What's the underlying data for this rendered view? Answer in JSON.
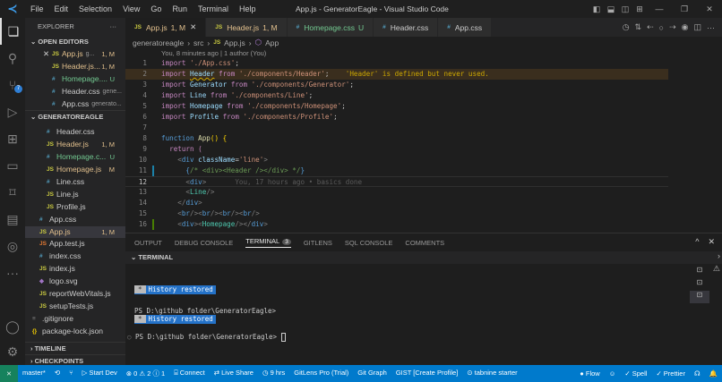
{
  "window": {
    "title": "App.js - GeneratorEagle - Visual Studio Code",
    "menu": [
      "File",
      "Edit",
      "Selection",
      "View",
      "Go",
      "Run",
      "Terminal",
      "Help"
    ]
  },
  "activity": {
    "scm_badge": "7"
  },
  "sidebar": {
    "title": "EXPLORER",
    "more": "···",
    "open_editors_label": "OPEN EDITORS",
    "open_editors": [
      {
        "icon": "JS",
        "name": "App.js",
        "desc": "g...",
        "status": "1, M",
        "cls": "mod",
        "ic": "js",
        "close": "✕"
      },
      {
        "icon": "JS",
        "name": "Header.js...",
        "desc": "",
        "status": "1, M",
        "cls": "mod",
        "ic": "js"
      },
      {
        "icon": "#",
        "name": "Homepage....",
        "desc": "",
        "status": "U",
        "cls": "unt",
        "ic": "css"
      },
      {
        "icon": "#",
        "name": "Header.css",
        "desc": "gene...",
        "status": "",
        "cls": "",
        "ic": "css"
      },
      {
        "icon": "#",
        "name": "App.css",
        "desc": "generato...",
        "status": "",
        "cls": "",
        "ic": "css"
      }
    ],
    "project_label": "GENERATOREAGLE",
    "tree": [
      {
        "icon": "#",
        "name": "Header.css",
        "status": "",
        "cls": "",
        "ic": "css",
        "indent": 2
      },
      {
        "icon": "JS",
        "name": "Header.js",
        "status": "1, M",
        "cls": "mod",
        "ic": "js",
        "indent": 2
      },
      {
        "icon": "#",
        "name": "Homepage.c...",
        "status": "U",
        "cls": "unt",
        "ic": "css",
        "indent": 2
      },
      {
        "icon": "JS",
        "name": "Homepage.js",
        "status": "M",
        "cls": "mod",
        "ic": "js",
        "indent": 2
      },
      {
        "icon": "#",
        "name": "Line.css",
        "status": "",
        "cls": "",
        "ic": "css",
        "indent": 2
      },
      {
        "icon": "JS",
        "name": "Line.js",
        "status": "",
        "cls": "",
        "ic": "js",
        "indent": 2
      },
      {
        "icon": "JS",
        "name": "Profile.js",
        "status": "",
        "cls": "",
        "ic": "js",
        "indent": 2
      },
      {
        "icon": "#",
        "name": "App.css",
        "status": "",
        "cls": "",
        "ic": "css",
        "indent": 1
      },
      {
        "icon": "JS",
        "name": "App.js",
        "status": "1, M",
        "cls": "mod",
        "ic": "js",
        "indent": 1,
        "selected": true
      },
      {
        "icon": "JS",
        "name": "App.test.js",
        "status": "",
        "cls": "",
        "ic": "testjs",
        "indent": 1
      },
      {
        "icon": "#",
        "name": "index.css",
        "status": "",
        "cls": "",
        "ic": "css",
        "indent": 1
      },
      {
        "icon": "JS",
        "name": "index.js",
        "status": "",
        "cls": "",
        "ic": "js",
        "indent": 1
      },
      {
        "icon": "◆",
        "name": "logo.svg",
        "status": "",
        "cls": "",
        "ic": "svg",
        "indent": 1
      },
      {
        "icon": "JS",
        "name": "reportWebVitals.js",
        "status": "",
        "cls": "",
        "ic": "js",
        "indent": 1
      },
      {
        "icon": "JS",
        "name": "setupTests.js",
        "status": "",
        "cls": "",
        "ic": "js",
        "indent": 1
      },
      {
        "icon": "≡",
        "name": ".gitignore",
        "status": "",
        "cls": "",
        "ic": "dim2",
        "indent": 0
      },
      {
        "icon": "{}",
        "name": "package-lock.json",
        "status": "",
        "cls": "",
        "ic": "y",
        "indent": 0
      }
    ],
    "timeline_label": "TIMELINE",
    "checkpoints_label": "CHECKPOINTS"
  },
  "tabs": [
    {
      "icon": "JS",
      "label": "App.js",
      "status": "1, M",
      "cls": "mod",
      "ic": "js",
      "active": true,
      "close": "✕"
    },
    {
      "icon": "JS",
      "label": "Header.js",
      "status": "1, M",
      "cls": "mod",
      "ic": "js"
    },
    {
      "icon": "#",
      "label": "Homepage.css",
      "status": "U",
      "cls": "unt",
      "ic": "css"
    },
    {
      "icon": "#",
      "label": "Header.css",
      "status": "",
      "cls": "",
      "ic": "css"
    },
    {
      "icon": "#",
      "label": "App.css",
      "status": "",
      "cls": "",
      "ic": "css"
    }
  ],
  "breadcrumb": [
    "generatoreagle",
    "src",
    "App.js",
    "App"
  ],
  "editor": {
    "codelens": "You, 8 minutes ago | 1 author (You)",
    "lines": [
      {
        "n": "1",
        "tokens": [
          [
            "import ",
            "k"
          ],
          [
            "'./App.css'",
            "s"
          ],
          [
            ";",
            "p"
          ]
        ]
      },
      {
        "n": "2",
        "hl": true,
        "tokens": [
          [
            "import ",
            "k"
          ],
          [
            "Header",
            "b"
          ],
          [
            " from ",
            "k"
          ],
          [
            "'./components/Header'",
            "s"
          ],
          [
            ";",
            "p"
          ],
          [
            "    'Header' is defined but never used.",
            "err"
          ]
        ]
      },
      {
        "n": "3",
        "tokens": [
          [
            "import ",
            "k"
          ],
          [
            "Generator",
            "b"
          ],
          [
            " from ",
            "k"
          ],
          [
            "'./components/Generator'",
            "s"
          ],
          [
            ";",
            "p"
          ]
        ]
      },
      {
        "n": "4",
        "tokens": [
          [
            "import ",
            "k"
          ],
          [
            "Line",
            "b"
          ],
          [
            " from ",
            "k"
          ],
          [
            "'./components/Line'",
            "s"
          ],
          [
            ";",
            "p"
          ]
        ]
      },
      {
        "n": "5",
        "tokens": [
          [
            "import ",
            "k"
          ],
          [
            "Homepage",
            "b"
          ],
          [
            " from ",
            "k"
          ],
          [
            "'./components/Homepage'",
            "s"
          ],
          [
            ";",
            "p"
          ]
        ]
      },
      {
        "n": "6",
        "tokens": [
          [
            "import ",
            "k"
          ],
          [
            "Profile",
            "b"
          ],
          [
            " from ",
            "k"
          ],
          [
            "'./components/Profile'",
            "s"
          ],
          [
            ";",
            "p"
          ]
        ]
      },
      {
        "n": "7",
        "tokens": []
      },
      {
        "n": "8",
        "tokens": [
          [
            "function ",
            "t"
          ],
          [
            "App",
            "f"
          ],
          [
            "() ",
            "y"
          ],
          [
            "{",
            "y"
          ]
        ]
      },
      {
        "n": "9",
        "tokens": [
          [
            "  return ",
            "k"
          ],
          [
            "(",
            "k"
          ]
        ]
      },
      {
        "n": "10",
        "tokens": [
          [
            "    <",
            "dim2"
          ],
          [
            "div ",
            "t"
          ],
          [
            "className",
            "b"
          ],
          [
            "=",
            "p"
          ],
          [
            "'line'",
            "s"
          ],
          [
            ">",
            "dim2"
          ]
        ]
      },
      {
        "n": "11",
        "gutter": "#1b81a8",
        "tokens": [
          [
            "      {",
            "t"
          ],
          [
            "/* <div><Header /></div> */",
            "c"
          ],
          [
            "}",
            "t"
          ]
        ]
      },
      {
        "n": "12",
        "cur": true,
        "tokens": [
          [
            "      <",
            "dim2"
          ],
          [
            "div",
            "t"
          ],
          [
            ">",
            "dim2"
          ],
          [
            "       You, 17 hours ago • basics done",
            "ghost"
          ]
        ]
      },
      {
        "n": "13",
        "tokens": [
          [
            "      <",
            "dim2"
          ],
          [
            "Line",
            "g"
          ],
          [
            "/>",
            "dim2"
          ]
        ]
      },
      {
        "n": "14",
        "tokens": [
          [
            "    </",
            "dim2"
          ],
          [
            "div",
            "t"
          ],
          [
            ">",
            "dim2"
          ]
        ]
      },
      {
        "n": "15",
        "tokens": [
          [
            "    <",
            "dim2"
          ],
          [
            "br",
            "t"
          ],
          [
            "/><",
            "dim2"
          ],
          [
            "br",
            "t"
          ],
          [
            "/><",
            "dim2"
          ],
          [
            "br",
            "t"
          ],
          [
            "/><",
            "dim2"
          ],
          [
            "br",
            "t"
          ],
          [
            "/>",
            "dim2"
          ]
        ]
      },
      {
        "n": "16",
        "gutter": "#487e02",
        "tokens": [
          [
            "    <",
            "dim2"
          ],
          [
            "div",
            "t"
          ],
          [
            "><",
            "dim2"
          ],
          [
            "Homepage",
            "g"
          ],
          [
            "/></",
            "dim2"
          ],
          [
            "div",
            "t"
          ],
          [
            ">",
            "dim2"
          ]
        ]
      }
    ]
  },
  "panel": {
    "tabs": [
      "OUTPUT",
      "DEBUG CONSOLE",
      "TERMINAL",
      "GITLENS",
      "SQL CONSOLE",
      "COMMENTS"
    ],
    "terminal_count": "3",
    "section": "TERMINAL",
    "history": "History restored",
    "history_marker": "*",
    "prompt": "PS D:\\github folder\\GeneratorEagle>"
  },
  "statusbar": {
    "left": [
      "master*",
      "⟲",
      "⑂",
      "▷ Start Dev",
      "⊗ 0 ⚠ 2 ⓘ 1",
      "⌸ Connect",
      "⇄ Live Share",
      "◷ 9 hrs",
      "GitLens Pro (Trial)",
      "Git Graph",
      "GIST [Create Profile]",
      "⊙ tabnine starter"
    ],
    "right": [
      "● Flow",
      "☺",
      "✓ Spell",
      "✓ Prettier",
      "☊",
      "🔔"
    ]
  }
}
